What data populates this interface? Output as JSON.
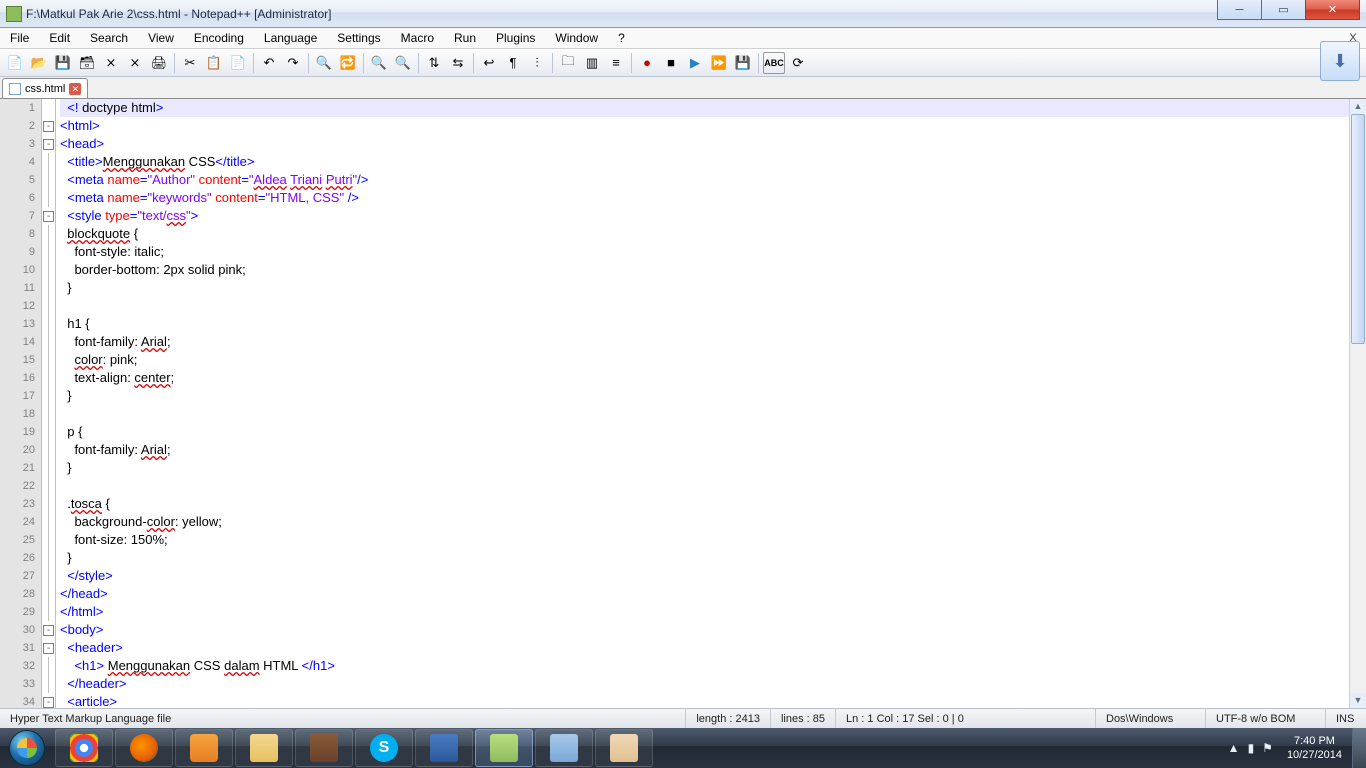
{
  "title": "F:\\Matkul Pak Arie 2\\css.html - Notepad++ [Administrator]",
  "menus": [
    "File",
    "Edit",
    "Search",
    "View",
    "Encoding",
    "Language",
    "Settings",
    "Macro",
    "Run",
    "Plugins",
    "Window",
    "?"
  ],
  "tab": {
    "label": "css.html"
  },
  "lines": [
    {
      "n": 1,
      "fold": "",
      "hl": true,
      "html": "  <span class='tag'>&lt;!</span><span class='txt'> doctype html</span><span class='tag'>&gt;</span>"
    },
    {
      "n": 2,
      "fold": "box",
      "html": "<span class='tag'>&lt;html&gt;</span>"
    },
    {
      "n": 3,
      "fold": "box",
      "html": "<span class='tag'>&lt;head&gt;</span>"
    },
    {
      "n": 4,
      "fold": "line",
      "html": "  <span class='tag'>&lt;title&gt;</span><span class='txt under'>Menggunakan</span><span class='txt'> CSS</span><span class='tag'>&lt;/title&gt;</span>"
    },
    {
      "n": 5,
      "fold": "line",
      "html": "  <span class='tag'>&lt;meta</span> <span class='attr'>name</span><span class='tag'>=</span><span class='val'>\"Author\"</span> <span class='attr'>content</span><span class='tag'>=</span><span class='val'>\"<span class='under'>Aldea</span> <span class='under'>Triani</span> <span class='under'>Putri</span>\"</span><span class='tag'>/&gt;</span>"
    },
    {
      "n": 6,
      "fold": "line",
      "html": "  <span class='tag'>&lt;meta</span> <span class='attr'>name</span><span class='tag'>=</span><span class='val'>\"keywords\"</span> <span class='attr'>content</span><span class='tag'>=</span><span class='val'>\"HTML, CSS\"</span> <span class='tag'>/&gt;</span>"
    },
    {
      "n": 7,
      "fold": "box",
      "html": "  <span class='tag'>&lt;style</span> <span class='attr'>type</span><span class='tag'>=</span><span class='val'>\"text/<span class='under'>css</span>\"</span><span class='tag'>&gt;</span>"
    },
    {
      "n": 8,
      "fold": "line",
      "html": "  <span class='under'>blockquote</span> {"
    },
    {
      "n": 9,
      "fold": "line",
      "html": "    font-style: italic;"
    },
    {
      "n": 10,
      "fold": "line",
      "html": "    border-bottom: 2px solid pink;"
    },
    {
      "n": 11,
      "fold": "line",
      "html": "  }"
    },
    {
      "n": 12,
      "fold": "line",
      "html": ""
    },
    {
      "n": 13,
      "fold": "line",
      "html": "  h1 {"
    },
    {
      "n": 14,
      "fold": "line",
      "html": "    font-family: <span class='under'>Arial</span>;"
    },
    {
      "n": 15,
      "fold": "line",
      "html": "    <span class='under'>color</span>: pink;"
    },
    {
      "n": 16,
      "fold": "line",
      "html": "    text-align: <span class='under'>center</span>;"
    },
    {
      "n": 17,
      "fold": "line",
      "html": "  }"
    },
    {
      "n": 18,
      "fold": "line",
      "html": ""
    },
    {
      "n": 19,
      "fold": "line",
      "html": "  p {"
    },
    {
      "n": 20,
      "fold": "line",
      "html": "    font-family: <span class='under'>Arial</span>;"
    },
    {
      "n": 21,
      "fold": "line",
      "html": "  }"
    },
    {
      "n": 22,
      "fold": "line",
      "html": ""
    },
    {
      "n": 23,
      "fold": "line",
      "html": "  .<span class='under'>tosca</span> {"
    },
    {
      "n": 24,
      "fold": "line",
      "html": "    background-<span class='under'>color</span>: yellow;"
    },
    {
      "n": 25,
      "fold": "line",
      "html": "    font-size: 150%;"
    },
    {
      "n": 26,
      "fold": "line",
      "html": "  }"
    },
    {
      "n": 27,
      "fold": "line",
      "html": "  <span class='tag'>&lt;/style&gt;</span>"
    },
    {
      "n": 28,
      "fold": "line",
      "html": "<span class='tag'>&lt;/head&gt;</span>"
    },
    {
      "n": 29,
      "fold": "line",
      "html": "<span class='tag'>&lt;/html&gt;</span>"
    },
    {
      "n": 30,
      "fold": "box",
      "html": "<span class='tag'>&lt;body&gt;</span>"
    },
    {
      "n": 31,
      "fold": "box",
      "html": "  <span class='tag'>&lt;header&gt;</span>"
    },
    {
      "n": 32,
      "fold": "line",
      "html": "    <span class='tag'>&lt;h1&gt;</span> <span class='txt under'>Menggunakan</span><span class='txt'> CSS </span><span class='txt under'>dalam</span><span class='txt'> HTML </span><span class='tag'>&lt;/h1&gt;</span>"
    },
    {
      "n": 33,
      "fold": "line",
      "html": "  <span class='tag'>&lt;/header&gt;</span>"
    },
    {
      "n": 34,
      "fold": "box",
      "html": "  <span class='tag'>&lt;article&gt;</span>"
    }
  ],
  "status": {
    "type": "Hyper Text Markup Language file",
    "length": "length : 2413",
    "lines": "lines : 85",
    "pos": "Ln : 1   Col : 17   Sel : 0 | 0",
    "eol": "Dos\\Windows",
    "enc": "UTF-8 w/o BOM",
    "ins": "INS"
  },
  "tray": {
    "time": "7:40 PM",
    "date": "10/27/2014"
  }
}
